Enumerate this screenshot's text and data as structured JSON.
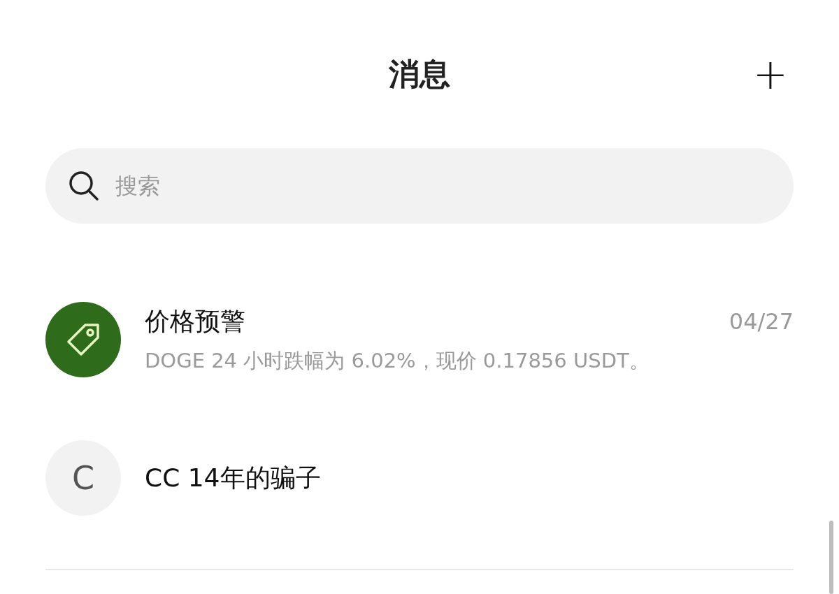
{
  "header": {
    "title": "消息",
    "add_button": "+"
  },
  "search": {
    "placeholder": "搜索"
  },
  "conversations": [
    {
      "kind": "icon",
      "title": "价格预警",
      "time": "04/27",
      "preview": "DOGE 24 小时跌幅为 6.02%，现价 0.17856 USDT。",
      "color": "#2e6b1a"
    },
    {
      "kind": "letter",
      "avatar_letter": "C",
      "title": "CC 14年的骗子",
      "color": "#f2f2f2"
    }
  ]
}
